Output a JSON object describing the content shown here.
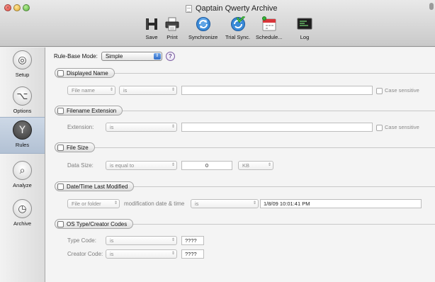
{
  "window": {
    "title": "Qaptain Qwerty Archive"
  },
  "toolbar": {
    "save": "Save",
    "print": "Print",
    "synchronize": "Synchronize",
    "trial_sync": "Trial Sync.",
    "schedule": "Schedule...",
    "log": "Log"
  },
  "sidebar": {
    "items": [
      {
        "label": "Setup",
        "icon": "target-icon"
      },
      {
        "label": "Options",
        "icon": "option-key-icon"
      },
      {
        "label": "Rules",
        "icon": "rules-icon"
      },
      {
        "label": "Analyze",
        "icon": "magnifier-icon"
      },
      {
        "label": "Archive",
        "icon": "clock-icon"
      }
    ],
    "active": "Rules"
  },
  "rule_base": {
    "label": "Rule-Base Mode:",
    "value": "Simple",
    "help": "?"
  },
  "sections": {
    "displayed_name": {
      "title": "Displayed Name",
      "target": "File name",
      "operator": "is",
      "value": "",
      "case_label": "Case sensitive"
    },
    "extension": {
      "title": "Filename Extension",
      "label": "Extension:",
      "operator": "is",
      "value": "",
      "case_label": "Case sensitive"
    },
    "file_size": {
      "title": "File Size",
      "label": "Data Size:",
      "operator": "is equal to",
      "value": "0",
      "unit": "KB"
    },
    "date_modified": {
      "title": "Date/Time Last Modified",
      "target": "File or folder",
      "middle_label": "modification date & time",
      "operator": "is",
      "value": "1/8/09 10:01:41 PM"
    },
    "os_type": {
      "title": "OS Type/Creator Codes",
      "type_label": "Type Code:",
      "type_operator": "is",
      "type_value": "????",
      "creator_label": "Creator Code:",
      "creator_operator": "is",
      "creator_value": "????"
    }
  },
  "colors": {
    "accent": "#2f6dc8",
    "active_sidebar": "#b9c7d8",
    "help": "#5a3a86"
  }
}
